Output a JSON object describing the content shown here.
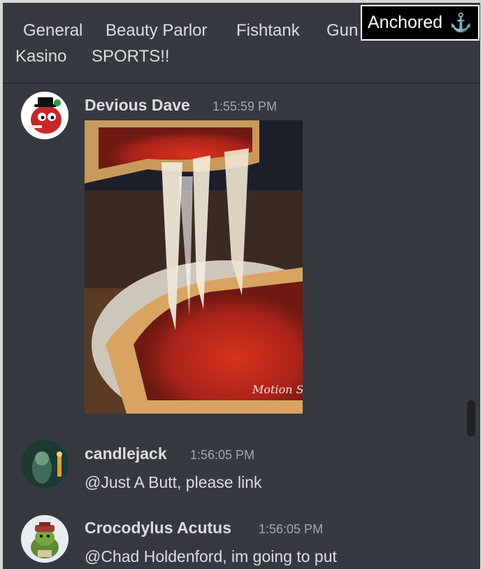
{
  "channels": [
    "General",
    "Beauty Parlor",
    "Fishtank",
    "Gun",
    "Kasino",
    "SPORTS!!"
  ],
  "anchored_label": "Anchored",
  "anchor_icon": "anchor-icon",
  "messages": [
    {
      "author": "Devious Dave",
      "time": "1:55:59 PM",
      "attachment": "gif-image",
      "image_watermark": "Motion Stills"
    },
    {
      "author": "candlejack",
      "time": "1:56:05 PM",
      "text": "@Just A Butt, please link"
    },
    {
      "author": "Crocodylus Acutus",
      "time": "1:56:05 PM",
      "text": "@Chad Holdenford, im going to put"
    }
  ],
  "colors": {
    "background": "#36393f",
    "text": "#dcddde",
    "timestamp": "#a3a6aa",
    "anchored_bg": "#000000"
  }
}
